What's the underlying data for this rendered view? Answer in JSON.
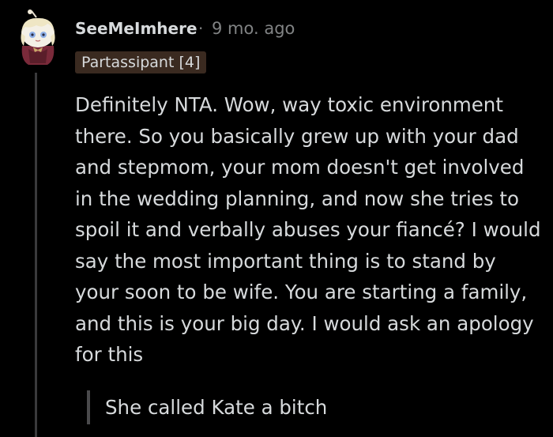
{
  "comment": {
    "username": "SeeMeImhere",
    "separator": "·",
    "timestamp": "9 mo. ago",
    "flair": "Partassipant [4]",
    "body": "Definitely NTA. Wow, way toxic environment there. So you basically grew up with your dad and stepmom, your mom doesn't get involved in the wedding planning, and now she tries to spoil it and verbally abuses your fiancé? I would say the most important thing is to stand by your soon to be wife. You are starting a family, and this is your big day. I would ask an apology for this",
    "quote": "She called Kate a bitch"
  },
  "colors": {
    "background": "#000000",
    "text": "#d7dadc",
    "meta": "#818384",
    "flair_bg": "#3a2a20",
    "thread_line": "#3a3a3c"
  },
  "icons": {
    "avatar": "snoo-avatar-icon"
  }
}
